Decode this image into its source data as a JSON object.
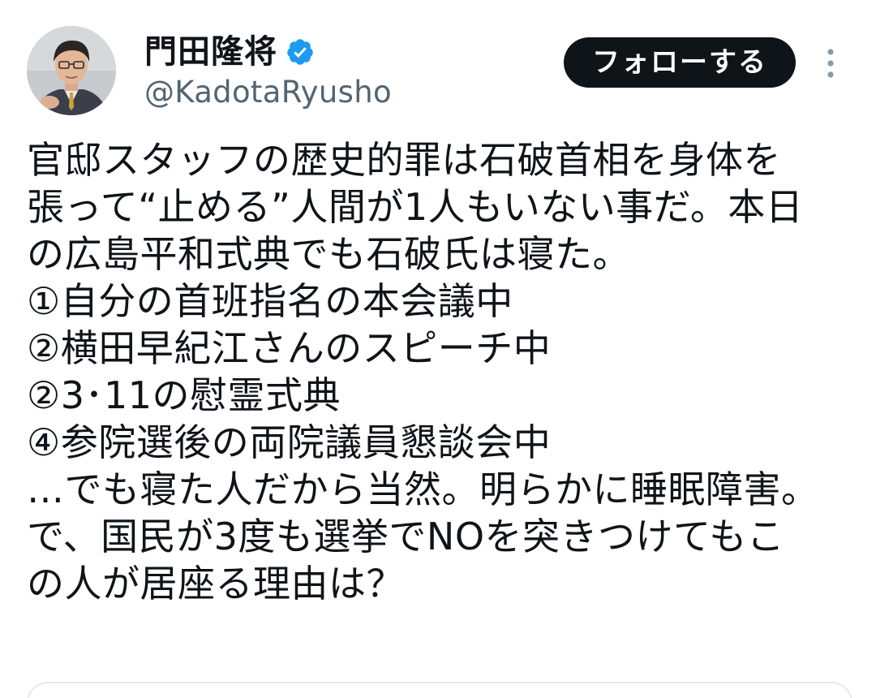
{
  "author": {
    "display_name": "門田隆将",
    "handle": "@KadotaRyusho",
    "verified": true,
    "verified_badge_color": "#1d9bf0"
  },
  "actions": {
    "follow_label": "フォローする",
    "more_icon": "more-vertical-icon"
  },
  "tweet": {
    "lines": [
      "官邸スタッフの歴史的罪は石破首相を身体を",
      "張って“止める”人間が1人もいない事だ。本日",
      "の広島平和式典でも石破氏は寝た。",
      "①自分の首班指名の本会議中",
      "②横田早紀江さんのスピーチ中",
      "②3･11の慰霊式典",
      "④参院選後の両院議員懇談会中",
      "…でも寝た人だから当然。明らかに睡眠障害。",
      "で、国民が3度も選挙でNOを突きつけてもこ",
      "の人が居座る理由は？"
    ]
  },
  "colors": {
    "text_primary": "#0f1419",
    "text_secondary": "#536471",
    "button_bg": "#0f1419",
    "button_text": "#ffffff"
  }
}
